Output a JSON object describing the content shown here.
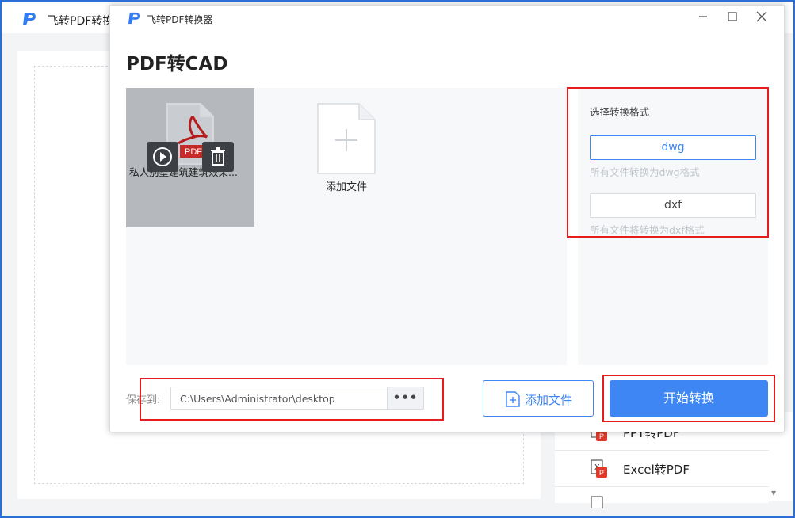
{
  "app": {
    "title": "飞转PDF转换",
    "brand_color": "#3d86f4"
  },
  "background": {
    "sidebar_items": [
      {
        "label": "PPT转PDF",
        "icon": "ppt-file-icon"
      },
      {
        "label": "Excel转PDF",
        "icon": "excel-file-icon"
      }
    ]
  },
  "dialog": {
    "title": "飞转PDF转换器",
    "heading": "PDF转CAD",
    "files": [
      {
        "name": "私人别墅建筑建筑效果图.pdf",
        "display_name": "私人别墅建筑建筑效果...",
        "badge": "PDF"
      }
    ],
    "add_file_card_label": "添加文件",
    "format": {
      "label": "选择转换格式",
      "options": [
        {
          "label": "dwg",
          "desc": "所有文件转换为dwg格式",
          "selected": true
        },
        {
          "label": "dxf",
          "desc": "所有文件将转换为dxf格式",
          "selected": false
        }
      ]
    },
    "save": {
      "label": "保存到:",
      "path": "C:\\Users\\Administrator\\desktop",
      "browse": "•••"
    },
    "add_file_button": "添加文件",
    "start_button": "开始转换",
    "highlight_color": "#e81c1c"
  }
}
